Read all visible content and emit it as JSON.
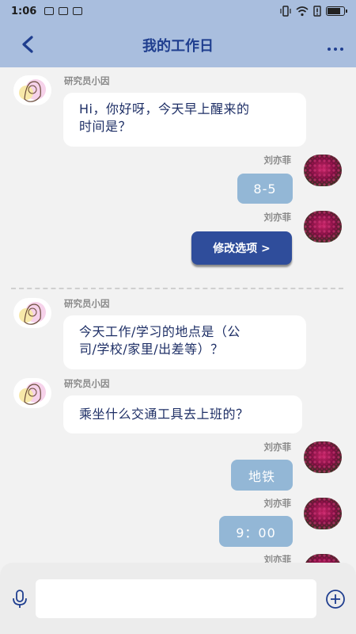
{
  "status_bar": {
    "time": "1:06",
    "battery_level": 0.85
  },
  "header": {
    "title": "我的工作日",
    "back_icon": "back-arrow-icon",
    "more_icon": "more-dots-icon"
  },
  "messages": {
    "m1": {
      "name": "研究员小因",
      "line1": "Hi，你好呀，今天早上醒来的",
      "line2": "时间是？"
    },
    "m2": {
      "name": "刘亦菲",
      "text": "8-5"
    },
    "m3": {
      "name": "刘亦菲",
      "button": "修改选项 >"
    },
    "m4": {
      "name": "研究员小因",
      "line1": "今天工作/学习的地点是（公",
      "line2": "司/学校/家里/出差等）？"
    },
    "m5": {
      "name": "研究员小因",
      "text": "乘坐什么交通工具去上班的？"
    },
    "m6": {
      "name": "刘亦菲",
      "text": "地铁"
    },
    "m7": {
      "name": "刘亦菲",
      "text": "9：00"
    },
    "m8": {
      "name": "刘亦菲"
    }
  },
  "input": {
    "placeholder": "",
    "mic_icon": "microphone-icon",
    "plus_icon": "plus-circle-icon"
  },
  "colors": {
    "header_bg": "#a9bede",
    "title": "#1f3e8f",
    "user_bubble": "#93b7d6",
    "button": "#2f4d9b"
  }
}
